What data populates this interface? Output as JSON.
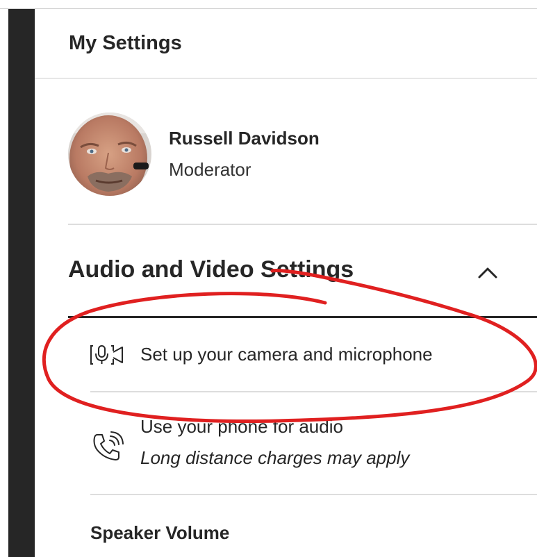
{
  "panel": {
    "title": "My Settings"
  },
  "user": {
    "name": "Russell Davidson",
    "role": "Moderator"
  },
  "audio_video": {
    "title": "Audio and Video Settings",
    "collapse_icon": "chevron-up-icon",
    "items": [
      {
        "label": "Set up your camera and microphone",
        "icon": "camera-microphone-icon"
      },
      {
        "label": "Use your phone for audio",
        "note": "Long distance charges may apply",
        "icon": "phone-audio-icon"
      }
    ],
    "speaker_volume_label": "Speaker Volume"
  },
  "colors": {
    "text": "#262626",
    "sidebar": "#262626",
    "divider": "#dddddd",
    "annotation": "#e02020"
  }
}
